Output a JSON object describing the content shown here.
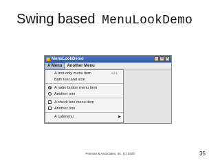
{
  "slide": {
    "title_prefix": "Swing based",
    "title_code": "MenuLookDemo",
    "footer": "Peirman & Associates, Inc. (c) 2003",
    "page_number": "35"
  },
  "window": {
    "title": "MenuLookDemo",
    "menus": [
      "A Menu",
      "Another Menu"
    ],
    "popup": {
      "items": [
        {
          "label": "A text-only menu item",
          "accelerator": "Alt-1",
          "kind": "plain"
        },
        {
          "label": "Both text and icon",
          "kind": "plain"
        },
        {
          "kind": "separator"
        },
        {
          "label": "A radio button menu item",
          "kind": "radio",
          "selected": true
        },
        {
          "label": "Another one",
          "kind": "radio",
          "selected": false
        },
        {
          "kind": "separator"
        },
        {
          "label": "A check box menu item",
          "kind": "check"
        },
        {
          "label": "Another one",
          "kind": "check"
        },
        {
          "kind": "separator"
        },
        {
          "label": "A submenu",
          "kind": "submenu"
        }
      ]
    }
  }
}
